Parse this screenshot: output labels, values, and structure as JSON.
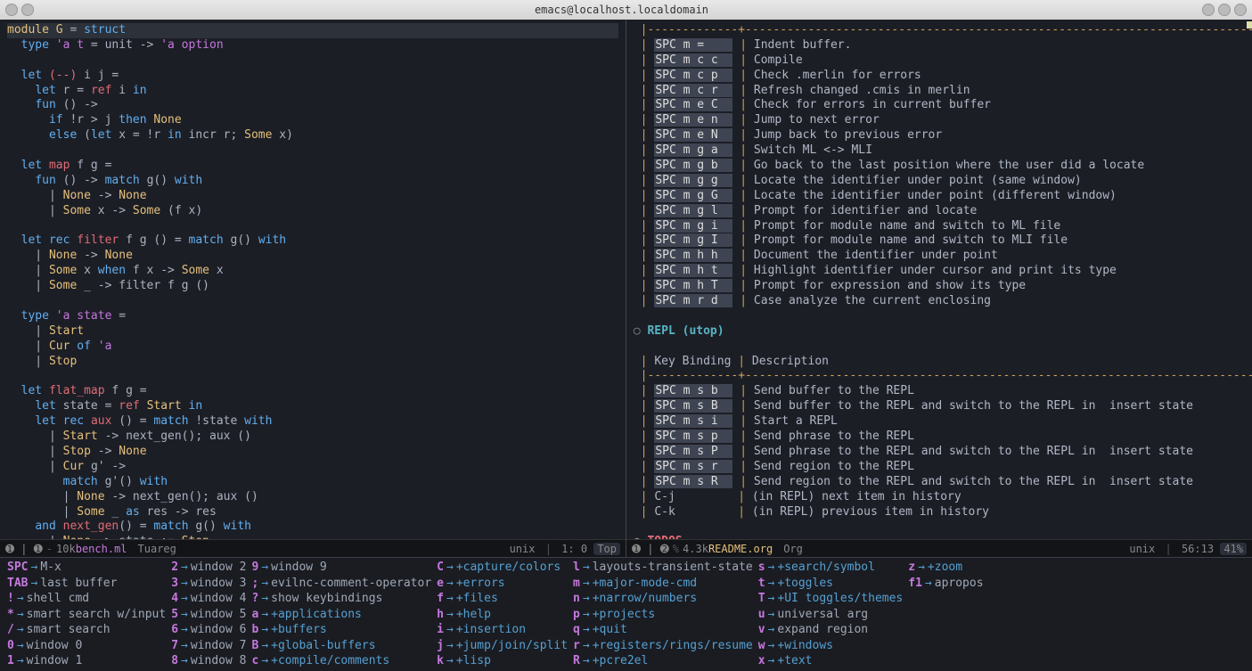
{
  "window": {
    "title": "emacs@localhost.localdomain"
  },
  "left_modeline": {
    "num": "1",
    "icons": "➊ | ➊",
    "size": "10k",
    "file": "bench.ml",
    "mode": "Tuareg",
    "os": "unix",
    "pos": "1: 0",
    "scroll": "Top"
  },
  "right_modeline": {
    "num": "2",
    "icons": "➊ | ➋",
    "size": "4.3k",
    "file": "README.org",
    "mode": "Org",
    "os": "unix",
    "pos": "56:13",
    "scroll": "41%"
  },
  "code_tokens": [
    [
      "module ",
      "mod"
    ],
    [
      "G",
      "mod"
    ],
    [
      " = ",
      "op"
    ],
    [
      "struct",
      "kw"
    ],
    [
      "\n",
      ""
    ],
    [
      "  ",
      "id"
    ],
    [
      "type ",
      "kw"
    ],
    [
      "'a ",
      "typ"
    ],
    [
      "t",
      "typ"
    ],
    [
      " = unit -> ",
      "op"
    ],
    [
      "'a option",
      "typ"
    ],
    [
      "\n",
      ""
    ],
    [
      "\n",
      ""
    ],
    [
      "  ",
      "id"
    ],
    [
      "let ",
      "kw"
    ],
    [
      "(--)",
      "fn"
    ],
    [
      " i j =",
      "id"
    ],
    [
      "\n",
      ""
    ],
    [
      "    ",
      "id"
    ],
    [
      "let ",
      "kw"
    ],
    [
      "r",
      "id"
    ],
    [
      " = ",
      "op"
    ],
    [
      "ref",
      "fn"
    ],
    [
      " i ",
      "id"
    ],
    [
      "in",
      "kw"
    ],
    [
      "\n",
      ""
    ],
    [
      "    ",
      "id"
    ],
    [
      "fun ",
      "kw"
    ],
    [
      "() ->",
      "op"
    ],
    [
      "\n",
      ""
    ],
    [
      "      ",
      "id"
    ],
    [
      "if ",
      "kw"
    ],
    [
      "!r > j ",
      "id"
    ],
    [
      "then ",
      "kw"
    ],
    [
      "None",
      "mod"
    ],
    [
      "\n",
      ""
    ],
    [
      "      ",
      "id"
    ],
    [
      "else ",
      "kw"
    ],
    [
      "(",
      "op"
    ],
    [
      "let ",
      "kw"
    ],
    [
      "x = !r ",
      "id"
    ],
    [
      "in ",
      "kw"
    ],
    [
      "incr r; ",
      "id"
    ],
    [
      "Some ",
      "mod"
    ],
    [
      "x)",
      "id"
    ],
    [
      "\n",
      ""
    ],
    [
      "\n",
      ""
    ],
    [
      "  ",
      "id"
    ],
    [
      "let ",
      "kw"
    ],
    [
      "map ",
      "fn"
    ],
    [
      "f g =",
      "id"
    ],
    [
      "\n",
      ""
    ],
    [
      "    ",
      "id"
    ],
    [
      "fun ",
      "kw"
    ],
    [
      "() -> ",
      "op"
    ],
    [
      "match ",
      "kw"
    ],
    [
      "g() ",
      "id"
    ],
    [
      "with",
      "kw"
    ],
    [
      "\n",
      ""
    ],
    [
      "      | ",
      "op"
    ],
    [
      "None ",
      "mod"
    ],
    [
      "-> ",
      "op"
    ],
    [
      "None",
      "mod"
    ],
    [
      "\n",
      ""
    ],
    [
      "      | ",
      "op"
    ],
    [
      "Some ",
      "mod"
    ],
    [
      "x -> ",
      "id"
    ],
    [
      "Some ",
      "mod"
    ],
    [
      "(f x)",
      "id"
    ],
    [
      "\n",
      ""
    ],
    [
      "\n",
      ""
    ],
    [
      "  ",
      "id"
    ],
    [
      "let ",
      "kw"
    ],
    [
      "rec ",
      "kw"
    ],
    [
      "filter ",
      "fn"
    ],
    [
      "f g () = ",
      "id"
    ],
    [
      "match ",
      "kw"
    ],
    [
      "g() ",
      "id"
    ],
    [
      "with",
      "kw"
    ],
    [
      "\n",
      ""
    ],
    [
      "    | ",
      "op"
    ],
    [
      "None ",
      "mod"
    ],
    [
      "-> ",
      "op"
    ],
    [
      "None",
      "mod"
    ],
    [
      "\n",
      ""
    ],
    [
      "    | ",
      "op"
    ],
    [
      "Some ",
      "mod"
    ],
    [
      "x ",
      "id"
    ],
    [
      "when ",
      "kw"
    ],
    [
      "f x -> ",
      "id"
    ],
    [
      "Some ",
      "mod"
    ],
    [
      "x",
      "id"
    ],
    [
      "\n",
      ""
    ],
    [
      "    | ",
      "op"
    ],
    [
      "Some ",
      "mod"
    ],
    [
      "_ -> filter f g ()",
      "id"
    ],
    [
      "\n",
      ""
    ],
    [
      "\n",
      ""
    ],
    [
      "  ",
      "id"
    ],
    [
      "type ",
      "kw"
    ],
    [
      "'a ",
      "typ"
    ],
    [
      "state ",
      "typ"
    ],
    [
      "=",
      "op"
    ],
    [
      "\n",
      ""
    ],
    [
      "    | ",
      "op"
    ],
    [
      "Start",
      "mod"
    ],
    [
      "\n",
      ""
    ],
    [
      "    | ",
      "op"
    ],
    [
      "Cur ",
      "mod"
    ],
    [
      "of ",
      "kw"
    ],
    [
      "'a",
      "typ"
    ],
    [
      "\n",
      ""
    ],
    [
      "    | ",
      "op"
    ],
    [
      "Stop",
      "mod"
    ],
    [
      "\n",
      ""
    ],
    [
      "\n",
      ""
    ],
    [
      "  ",
      "id"
    ],
    [
      "let ",
      "kw"
    ],
    [
      "flat_map ",
      "fn"
    ],
    [
      "f g =",
      "id"
    ],
    [
      "\n",
      ""
    ],
    [
      "    ",
      "id"
    ],
    [
      "let ",
      "kw"
    ],
    [
      "state",
      "id"
    ],
    [
      " = ",
      "op"
    ],
    [
      "ref ",
      "fn"
    ],
    [
      "Start ",
      "mod"
    ],
    [
      "in",
      "kw"
    ],
    [
      "\n",
      ""
    ],
    [
      "    ",
      "id"
    ],
    [
      "let ",
      "kw"
    ],
    [
      "rec ",
      "kw"
    ],
    [
      "aux ",
      "fn"
    ],
    [
      "() = ",
      "id"
    ],
    [
      "match ",
      "kw"
    ],
    [
      "!state ",
      "id"
    ],
    [
      "with",
      "kw"
    ],
    [
      "\n",
      ""
    ],
    [
      "      | ",
      "op"
    ],
    [
      "Start ",
      "mod"
    ],
    [
      "-> next_gen(); aux ()",
      "id"
    ],
    [
      "\n",
      ""
    ],
    [
      "      | ",
      "op"
    ],
    [
      "Stop ",
      "mod"
    ],
    [
      "-> ",
      "op"
    ],
    [
      "None",
      "mod"
    ],
    [
      "\n",
      ""
    ],
    [
      "      | ",
      "op"
    ],
    [
      "Cur ",
      "mod"
    ],
    [
      "g' ->",
      "id"
    ],
    [
      "\n",
      ""
    ],
    [
      "        ",
      "id"
    ],
    [
      "match ",
      "kw"
    ],
    [
      "g'() ",
      "id"
    ],
    [
      "with",
      "kw"
    ],
    [
      "\n",
      ""
    ],
    [
      "        | ",
      "op"
    ],
    [
      "None ",
      "mod"
    ],
    [
      "-> next_gen(); aux ()",
      "id"
    ],
    [
      "\n",
      ""
    ],
    [
      "        | ",
      "op"
    ],
    [
      "Some ",
      "mod"
    ],
    [
      "_ ",
      "id"
    ],
    [
      "as ",
      "kw"
    ],
    [
      "res -> res",
      "id"
    ],
    [
      "\n",
      ""
    ],
    [
      "    ",
      "id"
    ],
    [
      "and ",
      "kw"
    ],
    [
      "next_gen",
      "fn"
    ],
    [
      "() = ",
      "id"
    ],
    [
      "match ",
      "kw"
    ],
    [
      "g() ",
      "id"
    ],
    [
      "with",
      "kw"
    ],
    [
      "\n",
      ""
    ],
    [
      "      | ",
      "op"
    ],
    [
      "None ",
      "mod"
    ],
    [
      "-> state := ",
      "id"
    ],
    [
      "Stop",
      "mod"
    ],
    [
      "\n",
      ""
    ]
  ],
  "merlin_bindings": [
    {
      "k": "SPC m =",
      "d": "Indent buffer."
    },
    {
      "k": "SPC m c c",
      "d": "Compile"
    },
    {
      "k": "SPC m c p",
      "d": "Check .merlin for errors"
    },
    {
      "k": "SPC m c r",
      "d": "Refresh changed .cmis in merlin"
    },
    {
      "k": "SPC m e C",
      "d": "Check for errors in current buffer"
    },
    {
      "k": "SPC m e n",
      "d": "Jump to next error"
    },
    {
      "k": "SPC m e N",
      "d": "Jump back to previous error"
    },
    {
      "k": "SPC m g a",
      "d": "Switch ML <-> MLI"
    },
    {
      "k": "SPC m g b",
      "d": "Go back to the last position where the user did a locate"
    },
    {
      "k": "SPC m g g",
      "d": "Locate the identifier under point (same window)"
    },
    {
      "k": "SPC m g G",
      "d": "Locate the identifier under point (different window)"
    },
    {
      "k": "SPC m g l",
      "d": "Prompt for identifier and locate"
    },
    {
      "k": "SPC m g i",
      "d": "Prompt for module name and switch to ML file"
    },
    {
      "k": "SPC m g I",
      "d": "Prompt for module name and switch to MLI file"
    },
    {
      "k": "SPC m h h",
      "d": "Document the identifier under point"
    },
    {
      "k": "SPC m h t",
      "d": "Highlight identifier under cursor and print its type"
    },
    {
      "k": "SPC m h T",
      "d": "Prompt for expression and show its type"
    },
    {
      "k": "SPC m r d",
      "d": "Case analyze the current enclosing"
    }
  ],
  "repl_heading": "REPL (utop)",
  "repl_header": {
    "k": "Key Binding",
    "d": "Description"
  },
  "repl_bindings": [
    {
      "k": "SPC m s b",
      "d": "Send buffer to the REPL"
    },
    {
      "k": "SPC m s B",
      "d": "Send buffer to the REPL and switch to the REPL in  insert state"
    },
    {
      "k": "SPC m s i",
      "d": "Start a REPL"
    },
    {
      "k": "SPC m s p",
      "d": "Send phrase to the REPL"
    },
    {
      "k": "SPC m s P",
      "d": "Send phrase to the REPL and switch to the REPL in  insert state"
    },
    {
      "k": "SPC m s r",
      "d": "Send region to the REPL"
    },
    {
      "k": "SPC m s R",
      "d": "Send region to the REPL and switch to the REPL in  insert state"
    },
    {
      "k": "C-j",
      "d": "(in REPL) next item in history",
      "plain": true
    },
    {
      "k": "C-k",
      "d": "(in REPL) previous item in history",
      "plain": true
    }
  ],
  "todos_heading": "TODOS",
  "whichkey": {
    "cols": [
      [
        {
          "k": "SPC",
          "c": "M-x"
        },
        {
          "k": "TAB",
          "c": "last buffer"
        },
        {
          "k": "!",
          "c": "shell cmd"
        },
        {
          "k": "*",
          "c": "smart search w/input"
        },
        {
          "k": "/",
          "c": "smart search"
        },
        {
          "k": "0",
          "c": "window 0"
        },
        {
          "k": "1",
          "c": "window 1"
        }
      ],
      [
        {
          "k": "2",
          "c": "window 2"
        },
        {
          "k": "3",
          "c": "window 3"
        },
        {
          "k": "4",
          "c": "window 4"
        },
        {
          "k": "5",
          "c": "window 5"
        },
        {
          "k": "6",
          "c": "window 6"
        },
        {
          "k": "7",
          "c": "window 7"
        },
        {
          "k": "8",
          "c": "window 8"
        }
      ],
      [
        {
          "k": "9",
          "c": "window 9"
        },
        {
          "k": ";",
          "c": "evilnc-comment-operator"
        },
        {
          "k": "?",
          "c": "show keybindings"
        },
        {
          "k": "a",
          "c": "+applications",
          "g": true
        },
        {
          "k": "b",
          "c": "+buffers",
          "g": true
        },
        {
          "k": "B",
          "c": "+global-buffers",
          "g": true
        },
        {
          "k": "c",
          "c": "+compile/comments",
          "g": true
        }
      ],
      [
        {
          "k": "C",
          "c": "+capture/colors",
          "g": true
        },
        {
          "k": "e",
          "c": "+errors",
          "g": true
        },
        {
          "k": "f",
          "c": "+files",
          "g": true
        },
        {
          "k": "h",
          "c": "+help",
          "g": true
        },
        {
          "k": "i",
          "c": "+insertion",
          "g": true
        },
        {
          "k": "j",
          "c": "+jump/join/split",
          "g": true
        },
        {
          "k": "k",
          "c": "+lisp",
          "g": true
        }
      ],
      [
        {
          "k": "l",
          "c": "layouts-transient-state"
        },
        {
          "k": "m",
          "c": "+major-mode-cmd",
          "g": true
        },
        {
          "k": "n",
          "c": "+narrow/numbers",
          "g": true
        },
        {
          "k": "p",
          "c": "+projects",
          "g": true
        },
        {
          "k": "q",
          "c": "+quit",
          "g": true
        },
        {
          "k": "r",
          "c": "+registers/rings/resume",
          "g": true
        },
        {
          "k": "R",
          "c": "+pcre2el",
          "g": true
        }
      ],
      [
        {
          "k": "s",
          "c": "+search/symbol",
          "g": true
        },
        {
          "k": "t",
          "c": "+toggles",
          "g": true
        },
        {
          "k": "T",
          "c": "+UI toggles/themes",
          "g": true
        },
        {
          "k": "u",
          "c": "universal arg"
        },
        {
          "k": "v",
          "c": "expand region"
        },
        {
          "k": "w",
          "c": "+windows",
          "g": true
        },
        {
          "k": "x",
          "c": "+text",
          "g": true
        }
      ],
      [
        {
          "k": "z",
          "c": "+zoom",
          "g": true
        },
        {
          "k": "f1",
          "c": "apropos"
        }
      ]
    ]
  }
}
